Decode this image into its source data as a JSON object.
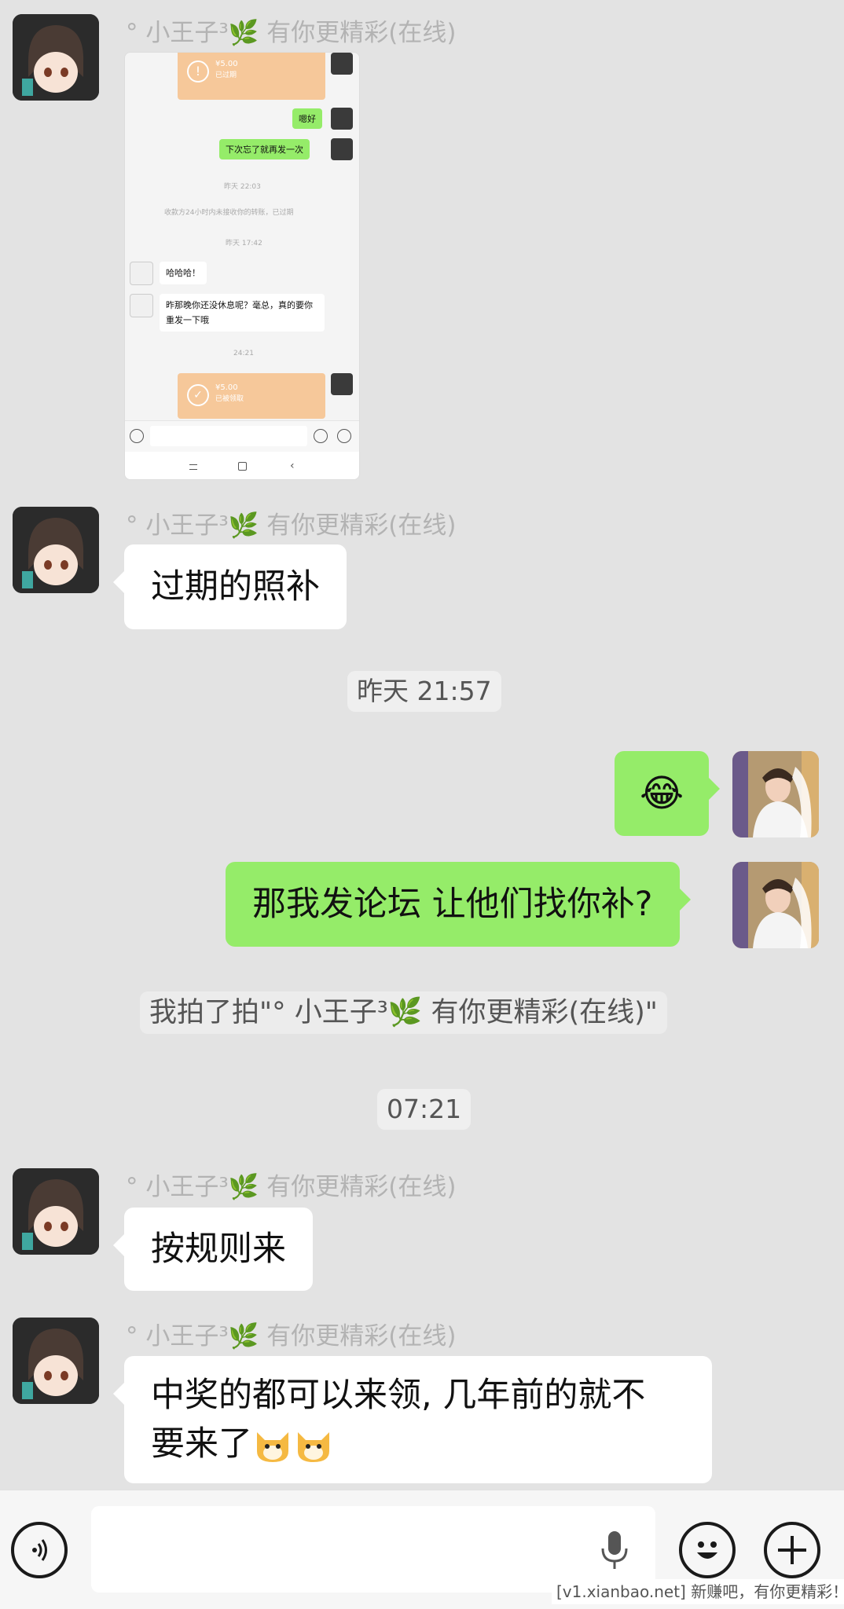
{
  "contact_name": "° 小王子³🌿 有你更精彩(在线)",
  "messages": {
    "m2_text": "过期的照补",
    "time1": "昨天 21:57",
    "m3_emoji": "😂",
    "m4_text": "那我发论坛 让他们找你补?",
    "sys_pat": "我拍了拍\"° 小王子³🌿 有你更精彩(在线)\"",
    "time2": "07:21",
    "m5_text": "按规则来",
    "m6_line1": "中奖的都可以来领, 几年前的就不",
    "m6_line2": "要来了"
  },
  "screenshot": {
    "tf1_amount": "¥5.00",
    "tf1_status": "已过期",
    "msg_a": "嗯好",
    "msg_b": "下次忘了就再发一次",
    "time_a": "昨天 22:03",
    "sys_note": "收款方24小时内未接收你的转账，已过期",
    "time_b": "昨天 17:42",
    "msg_c": "哈哈哈！",
    "msg_d": "昨那晚你还没休息呢？毫总，真的要你重发一下哦",
    "time_c": "24:21",
    "tf2_amount": "¥5.00",
    "tf2_status": "已被领取"
  },
  "footer": {
    "watermark": "[v1.xianbao.net] 新赚吧，有你更精彩！"
  },
  "icons": [
    "voice-icon",
    "mic-icon",
    "emoji-icon",
    "add-icon"
  ]
}
